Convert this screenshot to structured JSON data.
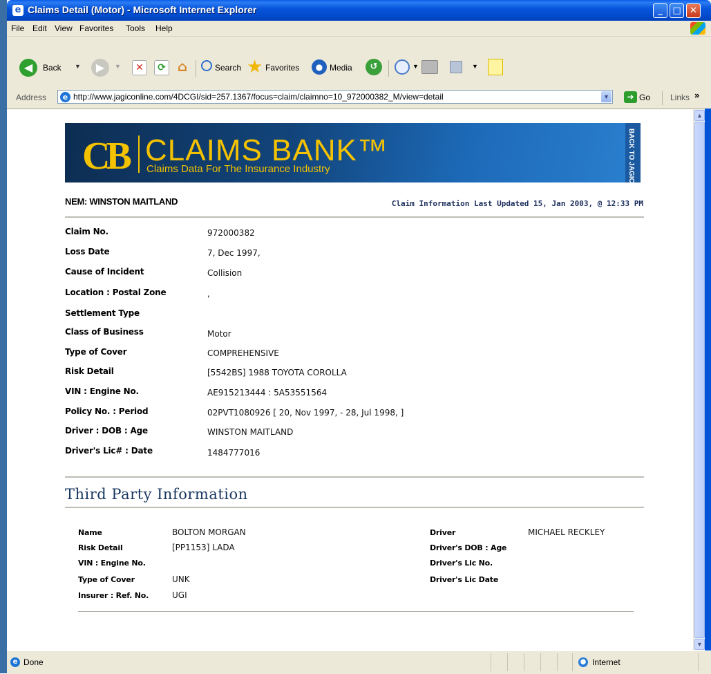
{
  "window": {
    "title": "Claims Detail (Motor) - Microsoft Internet Explorer",
    "buttons": {
      "minimize": "_",
      "maximize": "□",
      "close": "✕"
    }
  },
  "menu": [
    "File",
    "Edit",
    "View",
    "Favorites",
    "Tools",
    "Help"
  ],
  "toolbar": {
    "back": "Back",
    "search": "Search",
    "favorites": "Favorites",
    "media": "Media"
  },
  "address": {
    "label": "Address",
    "url": "http://www.jagiconline.com/4DCGI/sid=257.1367/focus=claim/claimno=10_972000382_M/view=detail",
    "go": "Go",
    "links": "Links"
  },
  "banner": {
    "logo": "CB",
    "name": "CLAIMS BANK™",
    "tagline": "Claims Data For The Insurance Industry",
    "back_tab": "BACK TO JAGIC"
  },
  "header": {
    "nem": "NEM: WINSTON MAITLAND",
    "updated": "Claim Information Last Updated 15, Jan 2003, @ 12:33 PM"
  },
  "claim": [
    {
      "label": "Claim No.",
      "value": "972000382"
    },
    {
      "label": "Loss Date",
      "value": "7, Dec 1997,"
    },
    {
      "label": "Cause of Incident",
      "value": "Collision"
    },
    {
      "label": "Location : Postal Zone",
      "value": ","
    },
    {
      "label": "Settlement Type",
      "value": ""
    },
    {
      "label": "Class of Business",
      "value": "Motor"
    },
    {
      "label": "Type of Cover",
      "value": "COMPREHENSIVE"
    },
    {
      "label": "Risk Detail",
      "value": "[5542BS] 1988 TOYOTA COROLLA"
    },
    {
      "label": "VIN : Engine No.",
      "value": "AE915213444 : 5A53551564"
    },
    {
      "label": "Policy No. : Period",
      "value": "02PVT1080926 [ 20, Nov 1997, - 28, Jul 1998, ]"
    },
    {
      "label": "Driver : DOB : Age",
      "value": "WINSTON MAITLAND"
    },
    {
      "label": "Driver's Lic# : Date",
      "value": "1484777016"
    }
  ],
  "third_party": {
    "heading": "Third Party Information",
    "left": [
      {
        "label": "Name",
        "value": "BOLTON MORGAN"
      },
      {
        "label": "Risk Detail",
        "value": "[PP1153] LADA"
      },
      {
        "label": "VIN : Engine No.",
        "value": ""
      },
      {
        "label": "Type of Cover",
        "value": "UNK"
      },
      {
        "label": "Insurer : Ref. No.",
        "value": "UGI"
      }
    ],
    "right": [
      {
        "label": "Driver",
        "value": "MICHAEL RECKLEY"
      },
      {
        "label": "Driver's DOB : Age",
        "value": ""
      },
      {
        "label": "Driver's Lic No.",
        "value": ""
      },
      {
        "label": "Driver's Lic Date",
        "value": ""
      }
    ]
  },
  "status": {
    "text": "Done",
    "zone": "Internet"
  },
  "colors": {
    "title_bar": "#0a5ee8",
    "banner_gold": "#f5c200",
    "banner_blue": "#12457c",
    "heading_navy": "#17365f"
  }
}
